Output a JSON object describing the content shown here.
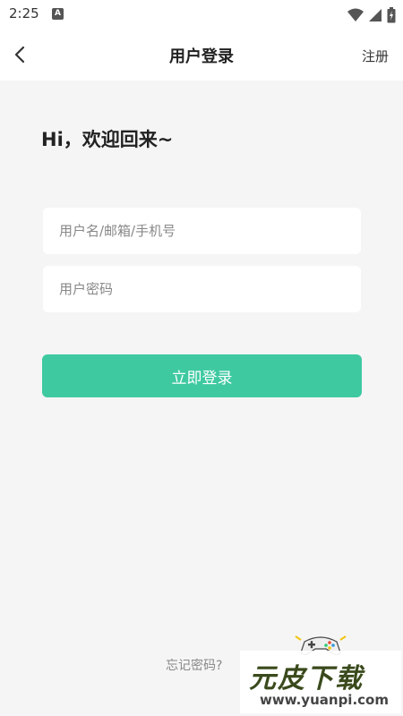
{
  "status_bar": {
    "time": "2:25",
    "notification_icon": "a-letter-icon",
    "icons": [
      "wifi-icon",
      "signal-icon",
      "battery-icon"
    ]
  },
  "header": {
    "title": "用户登录",
    "back_icon": "chevron-left-icon",
    "register_label": "注册"
  },
  "greeting": "Hi，欢迎回来~",
  "form": {
    "username_placeholder": "用户名/邮箱/手机号",
    "username_value": "",
    "password_placeholder": "用户密码",
    "password_value": "",
    "login_label": "立即登录"
  },
  "forgot_password_label": "忘记密码?",
  "watermark": {
    "title": "元皮下载",
    "url": "www.yuanpi.com"
  },
  "colors": {
    "accent": "#3ec9a1",
    "background": "#f5f5f5",
    "surface": "#ffffff",
    "watermark_text": "#3a4a1c"
  }
}
